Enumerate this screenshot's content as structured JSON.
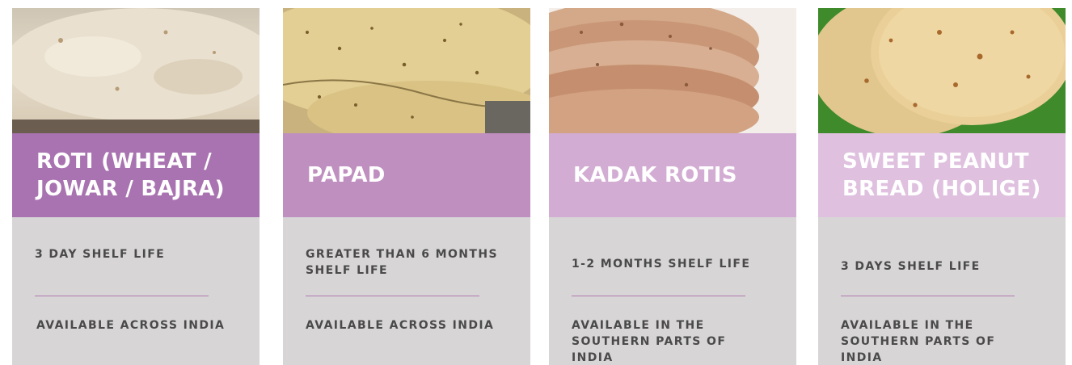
{
  "colors": {
    "banner_1": "#a873b0",
    "banner_2": "#bf8fc0",
    "banner_3": "#d2acd3",
    "banner_4": "#dfc1df",
    "details_bg": "#d8d5d6",
    "divider": "#b07ab2",
    "detail_text": "#4a4a4a"
  },
  "cards": [
    {
      "title": "ROTI (WHEAT / JOWAR / BAJRA)",
      "shelf_life": "3 DAY SHELF LIFE",
      "availability": "AVAILABLE ACROSS INDIA"
    },
    {
      "title": "PAPAD",
      "shelf_life": "GREATER THAN 6 MONTHS SHELF LIFE",
      "availability": "AVAILABLE ACROSS INDIA"
    },
    {
      "title": "KADAK ROTIS",
      "shelf_life": "1-2 MONTHS SHELF LIFE",
      "availability": "AVAILABLE IN THE SOUTHERN PARTS OF INDIA"
    },
    {
      "title": "SWEET PEANUT BREAD (HOLIGE)",
      "shelf_life": "3 DAYS SHELF LIFE",
      "availability": "AVAILABLE IN THE SOUTHERN PARTS OF INDIA"
    }
  ]
}
